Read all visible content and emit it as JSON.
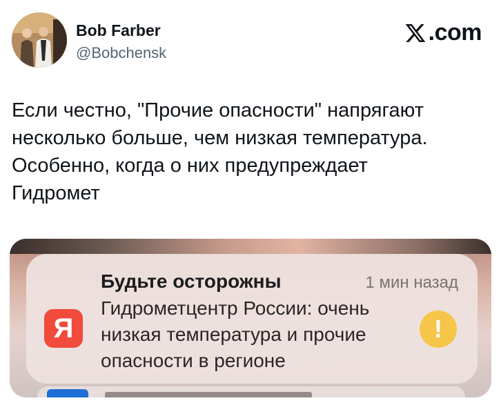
{
  "author": {
    "name": "Bob Farber",
    "handle": "@Bobchensk",
    "avatar_icon": "profile-photo"
  },
  "brand": {
    "logo_icon": "x-logo-icon",
    "suffix": ".com"
  },
  "tweet": {
    "lines": [
      "Если честно, \"Прочие опасности\" напрягают",
      "несколько больше, чем низкая температура.",
      "Особенно, когда о них предупреждает",
      "Гидромет"
    ]
  },
  "notification": {
    "app_icon_letter": "Я",
    "app_icon_color": "#f04b3b",
    "title": "Будьте осторожны",
    "time": "1 мин назад",
    "body_lines": [
      "Гидрометцентр России: очень",
      "низкая температура и прочие",
      "опасности в регионе"
    ],
    "alert_symbol": "!",
    "alert_color": "#f6c64a"
  }
}
